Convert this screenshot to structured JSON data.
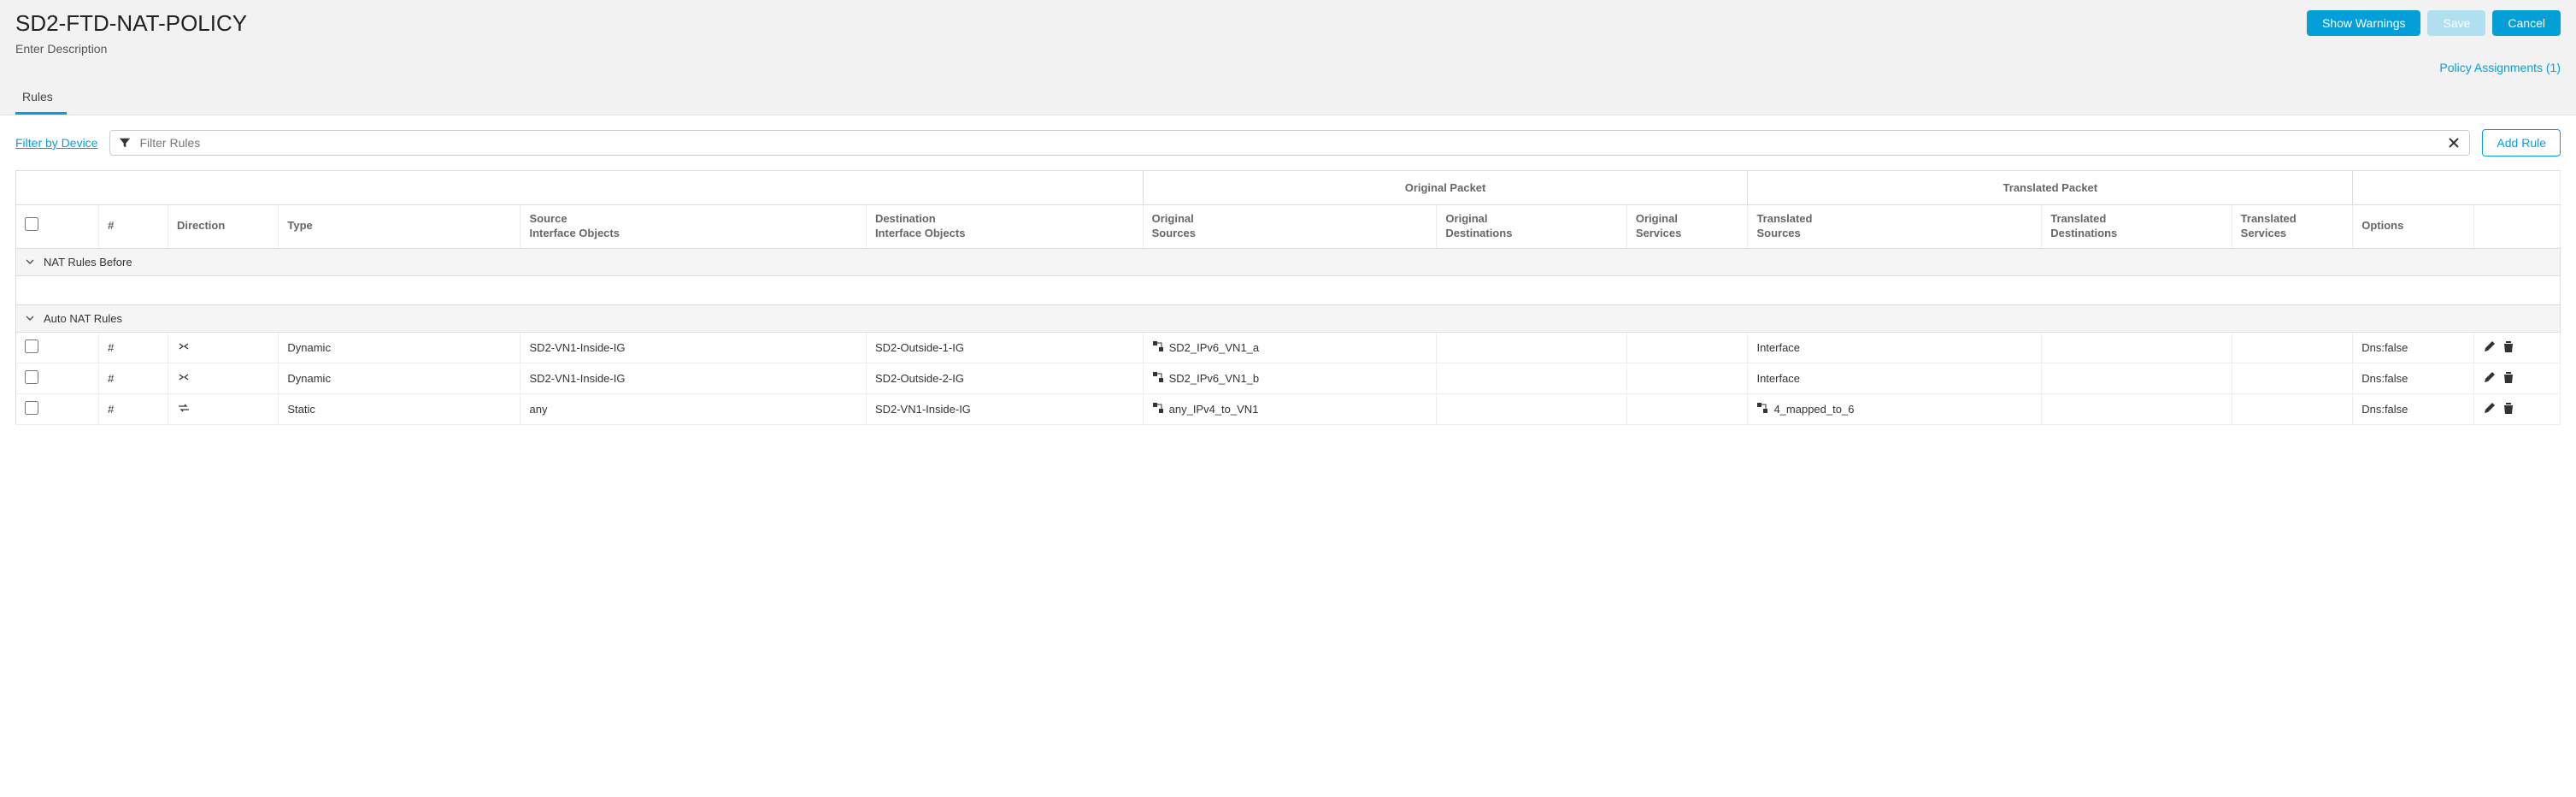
{
  "header": {
    "title": "SD2-FTD-NAT-POLICY",
    "description_placeholder": "Enter Description",
    "buttons": {
      "show_warnings": "Show Warnings",
      "save": "Save",
      "cancel": "Cancel"
    },
    "policy_assignments": "Policy Assignments (1)"
  },
  "tabs": {
    "rules": "Rules"
  },
  "toolbar": {
    "filter_by_device": "Filter by Device",
    "filter_placeholder": "Filter Rules",
    "add_rule": "Add Rule"
  },
  "columns": {
    "group_original": "Original Packet",
    "group_translated": "Translated Packet",
    "index": "#",
    "direction": "Direction",
    "type": "Type",
    "src_if": "Source\nInterface Objects",
    "dst_if": "Destination\nInterface Objects",
    "orig_src": "Original\nSources",
    "orig_dst": "Original\nDestinations",
    "orig_svc": "Original\nServices",
    "tr_src": "Translated\nSources",
    "tr_dst": "Translated\nDestinations",
    "tr_svc": "Translated\nServices",
    "options": "Options"
  },
  "sections": {
    "before": "NAT Rules Before",
    "auto": "Auto NAT Rules"
  },
  "rows": [
    {
      "idx": "#",
      "dir_icon": "bidir-x",
      "type": "Dynamic",
      "src_if": "SD2-VN1-Inside-IG",
      "dst_if": "SD2-Outside-1-IG",
      "orig_src": "SD2_IPv6_VN1_a",
      "orig_dst": "",
      "orig_svc": "",
      "tr_src": "Interface",
      "tr_dst": "",
      "tr_svc": "",
      "options": "Dns:false"
    },
    {
      "idx": "#",
      "dir_icon": "bidir-x",
      "type": "Dynamic",
      "src_if": "SD2-VN1-Inside-IG",
      "dst_if": "SD2-Outside-2-IG",
      "orig_src": "SD2_IPv6_VN1_b",
      "orig_dst": "",
      "orig_svc": "",
      "tr_src": "Interface",
      "tr_dst": "",
      "tr_svc": "",
      "options": "Dns:false"
    },
    {
      "idx": "#",
      "dir_icon": "bidir",
      "type": "Static",
      "src_if": "any",
      "dst_if": "SD2-VN1-Inside-IG",
      "orig_src": "any_IPv4_to_VN1",
      "orig_dst": "",
      "orig_svc": "",
      "tr_src": "4_mapped_to_6",
      "tr_src_icon": true,
      "tr_dst": "",
      "tr_svc": "",
      "options": "Dns:false"
    }
  ]
}
